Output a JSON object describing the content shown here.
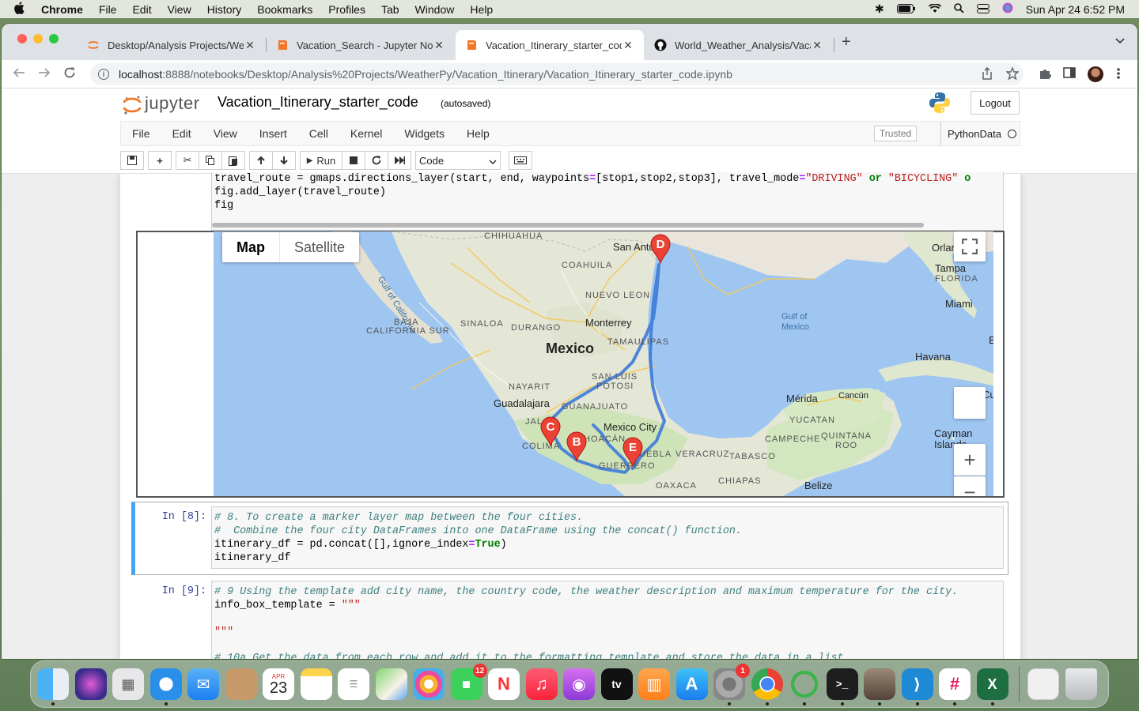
{
  "menubar": {
    "app_name": "Chrome",
    "items": [
      "File",
      "Edit",
      "View",
      "History",
      "Bookmarks",
      "Profiles",
      "Tab",
      "Window",
      "Help"
    ],
    "datetime": "Sun Apr 24  6:52 PM"
  },
  "browser": {
    "tabs": [
      {
        "title": "Desktop/Analysis Projects/Wea",
        "favicon": "jupyter-icon",
        "active": false
      },
      {
        "title": "Vacation_Search - Jupyter Not",
        "favicon": "notebook-icon",
        "active": false
      },
      {
        "title": "Vacation_Itinerary_starter_cod",
        "favicon": "notebook-icon",
        "active": true
      },
      {
        "title": "World_Weather_Analysis/Vaca",
        "favicon": "github-icon",
        "active": false
      }
    ],
    "url_host": "localhost",
    "url_path": ":8888/notebooks/Desktop/Analysis%20Projects/WeatherPy/Vacation_Itinerary/Vacation_Itinerary_starter_code.ipynb"
  },
  "jupyter": {
    "logo_text": "jupyter",
    "notebook_title": "Vacation_Itinerary_starter_code",
    "autosave_status": "(autosaved)",
    "logout_label": "Logout",
    "menu": [
      "File",
      "Edit",
      "View",
      "Insert",
      "Cell",
      "Kernel",
      "Widgets",
      "Help"
    ],
    "trusted_label": "Trusted",
    "kernel_name": "PythonData",
    "toolbar": {
      "run_label": "Run",
      "cell_type": "Code"
    }
  },
  "cells": {
    "top_code_line1_a": "travel_route = gmaps.directions_layer(start, end, waypoints",
    "top_code_line1_b": "=",
    "top_code_line1_c": "[stop1,stop2,stop3], travel_mode",
    "top_code_line1_d": "=",
    "top_code_line1_e": "\"DRIVING\"",
    "top_code_line1_f": " or ",
    "top_code_line1_g": "\"BICYCLING\"",
    "top_code_line1_h": " o",
    "top_code_line2": "fig.add_layer(travel_route)",
    "top_code_line3": "fig",
    "cell8_prompt": "In [8]:",
    "cell8_comment1": "# 8. To create a marker layer map between the four cities.",
    "cell8_comment2": "#  Combine the four city DataFrames into one DataFrame using the concat() function.",
    "cell8_line3_a": "itinerary_df = pd.concat([],ignore_index",
    "cell8_line3_b": "=",
    "cell8_line3_c": "True",
    "cell8_line3_d": ")",
    "cell8_line4": "itinerary_df",
    "cell9_prompt": "In [9]:",
    "cell9_comment1": "# 9 Using the template add city name, the country code, the weather description and maximum temperature for the city.",
    "cell9_line2_a": "info_box_template = ",
    "cell9_line2_b": "\"\"\"",
    "cell9_line4": "\"\"\"",
    "cell9_comment5": "# 10a Get the data from each row and add it to the formatting template and store the data in a list."
  },
  "map": {
    "type_buttons": [
      "Map",
      "Satellite"
    ],
    "markers": [
      "D",
      "C",
      "B",
      "E"
    ],
    "labels": {
      "chihuahua": "CHIHUAHUA",
      "san_antonio": "San Antonio",
      "orlando": "Orlan",
      "tampa": "Tampa",
      "florida": "FLORIDA",
      "coahuila": "COAHUILA",
      "nuevo_leon": "NUEVO LEON",
      "miami": "Miami",
      "gulf_of_california": "Gulf of California",
      "baja": "BAJA",
      "california_sur": "CALIFORNIA SUR",
      "sinaloa": "SINALOA",
      "durango": "DURANGO",
      "monterrey": "Monterrey",
      "gulf_of_mexico_1": "Gulf of",
      "gulf_of_mexico_2": "Mexico",
      "mexico": "Mexico",
      "tamaulipas": "TAMAULIPAS",
      "havana": "Havana",
      "b_edge": "B",
      "san_luis": "SAN LUIS",
      "potosi": "POTOSI",
      "nayarit": "NAYARIT",
      "guadalajara": "Guadalajara",
      "guanajuato": "GUANAJUATO",
      "merida": "Mérida",
      "cancun": "Cancún",
      "yucatan": "YUCATAN",
      "cu_edge": "Cu",
      "jalisco": "JAL",
      "mexico_city": "Mexico City",
      "michoacan": "HOACÁN",
      "campeche": "CAMPECHE",
      "quintana": "QUINTANA",
      "roo": "ROO",
      "cayman": "Cayman",
      "islands": "Islands",
      "colima": "COLIMA",
      "puebla": "UEBLA",
      "veracruz": "VERACRUZ",
      "tabasco": "TABASCO",
      "guerrero": "GUERRERO",
      "oaxaca": "OAXACA",
      "chiapas": "CHIAPAS",
      "belize": "Belize"
    }
  },
  "dock": {
    "apps": [
      "finder-icon",
      "siri-icon",
      "launchpad-icon",
      "safari-icon",
      "mail-icon",
      "contacts-icon",
      "calendar-icon",
      "notes-icon",
      "reminders-icon",
      "maps-icon",
      "photos-icon",
      "facetime-icon",
      "news-icon",
      "music-icon",
      "podcasts-icon",
      "appletv-icon",
      "books-icon",
      "appstore-icon",
      "system-preferences-icon",
      "chrome-icon",
      "anaconda-icon",
      "terminal-icon",
      "preview-icon",
      "vscode-icon",
      "slack-icon",
      "excel-icon"
    ],
    "calendar_month": "APR",
    "calendar_day": "23",
    "facetime_badge": "12",
    "sysprefs_badge": "1",
    "appletv_label": "tv"
  }
}
